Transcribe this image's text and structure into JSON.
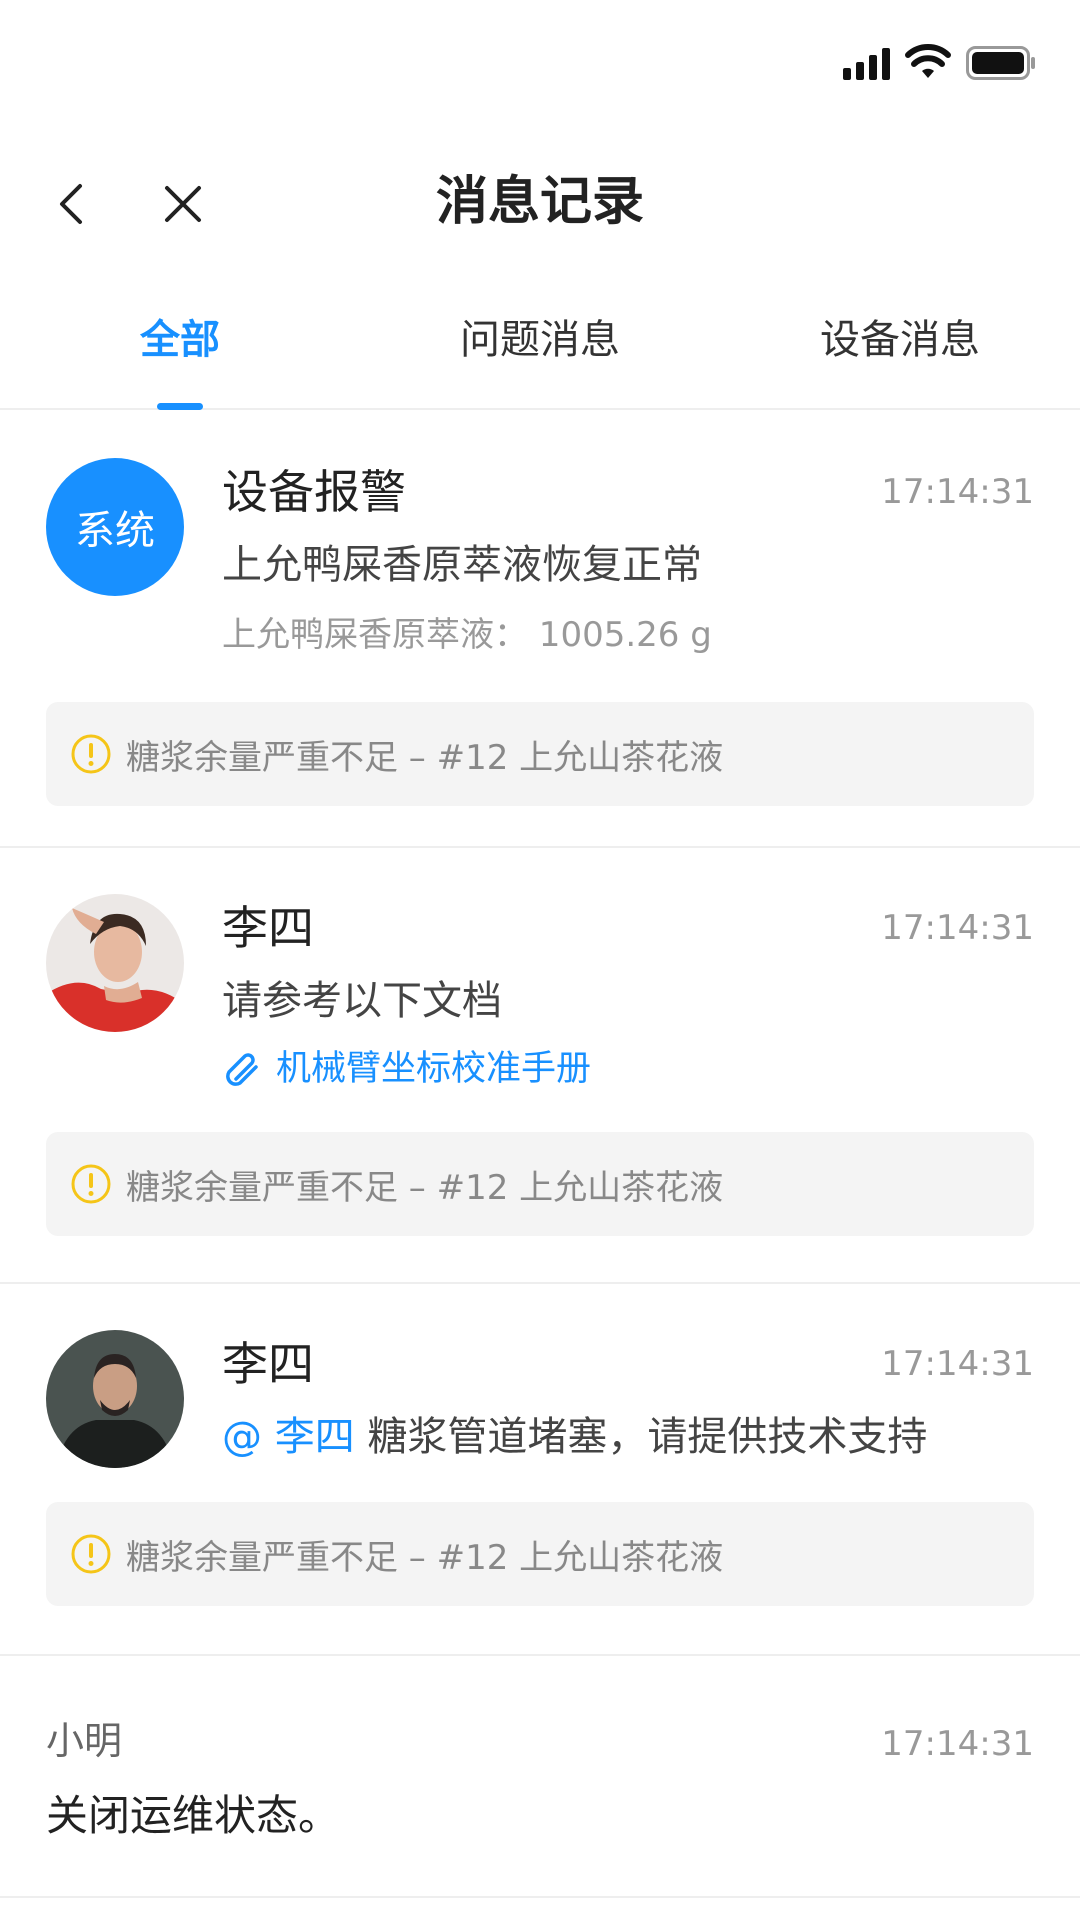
{
  "status_bar": {
    "signal_icon": "signal-icon",
    "wifi_icon": "wifi-icon",
    "battery_icon": "battery-icon"
  },
  "nav": {
    "title": "消息记录",
    "back_icon": "chevron-left-icon",
    "close_icon": "close-icon"
  },
  "tabs": [
    {
      "label": "全部",
      "active": true
    },
    {
      "label": "问题消息",
      "active": false
    },
    {
      "label": "设备消息",
      "active": false
    }
  ],
  "colors": {
    "accent": "#1890ff",
    "warning": "#f5c518",
    "muted_text": "#999999",
    "warn_bg": "#f4f4f4"
  },
  "messages": [
    {
      "avatar_text": "系统",
      "sender": "设备报警",
      "time": "17:14:31",
      "line1": "上允鸭屎香原萃液恢复正常",
      "line2": "上允鸭屎香原萃液： 1005.26 g",
      "warning": "糖浆余量严重不足 – #12 上允山茶花液"
    },
    {
      "sender": "李四",
      "time": "17:14:31",
      "line1": "请参考以下文档",
      "attachment": "机械臂坐标校准手册",
      "warning": "糖浆余量严重不足 – #12 上允山茶花液"
    },
    {
      "sender": "李四",
      "time": "17:14:31",
      "mention": "@ 李四",
      "line1": "糖浆管道堵塞，请提供技术支持",
      "warning": "糖浆余量严重不足 – #12 上允山茶花液"
    },
    {
      "sender": "小明",
      "time": "17:14:31",
      "line1": "关闭运维状态。"
    }
  ]
}
